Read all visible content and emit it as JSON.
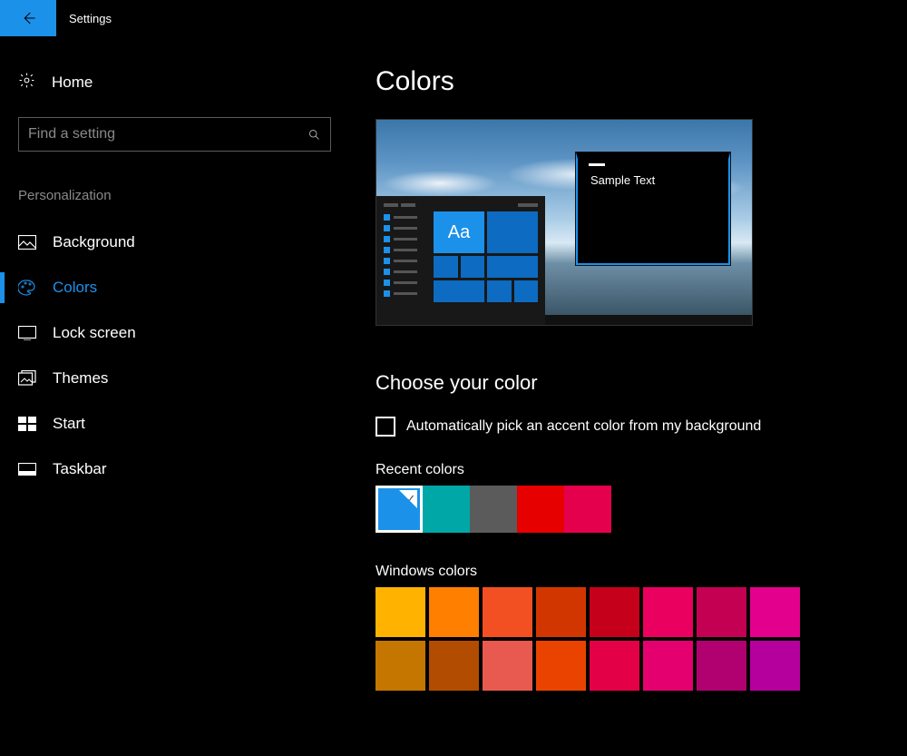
{
  "header": {
    "title": "Settings"
  },
  "sidebar": {
    "home": "Home",
    "search_placeholder": "Find a setting",
    "section": "Personalization",
    "items": [
      {
        "label": "Background",
        "icon": "picture-icon"
      },
      {
        "label": "Colors",
        "icon": "palette-icon",
        "active": true
      },
      {
        "label": "Lock screen",
        "icon": "lockscreen-icon"
      },
      {
        "label": "Themes",
        "icon": "themes-icon"
      },
      {
        "label": "Start",
        "icon": "start-icon"
      },
      {
        "label": "Taskbar",
        "icon": "taskbar-icon"
      }
    ]
  },
  "main": {
    "title": "Colors",
    "preview": {
      "tile_label": "Aa",
      "sample_text": "Sample Text"
    },
    "choose_heading": "Choose your color",
    "auto_pick_label": "Automatically pick an accent color from my background",
    "auto_pick_checked": false,
    "recent_heading": "Recent colors",
    "recent_colors": [
      {
        "hex": "#1b91ea",
        "selected": true
      },
      {
        "hex": "#00a7a7"
      },
      {
        "hex": "#5b5b5b"
      },
      {
        "hex": "#e60000"
      },
      {
        "hex": "#e5004d"
      }
    ],
    "windows_heading": "Windows colors",
    "windows_colors": [
      "#ffb300",
      "#ff7f00",
      "#f25022",
      "#d23600",
      "#c4001b",
      "#ea005e",
      "#c30052",
      "#e3008c",
      "#c47600",
      "#b24c00",
      "#e85a4f",
      "#ea4300",
      "#e40046",
      "#e5006f",
      "#b1006f",
      "#b5009e"
    ],
    "accent": "#1b91ea"
  }
}
